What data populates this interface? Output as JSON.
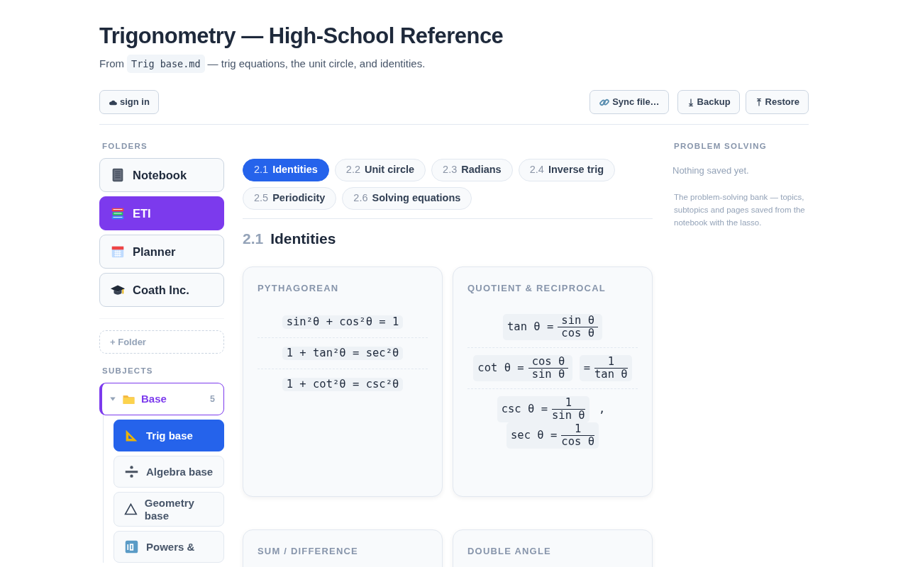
{
  "header": {
    "title": "Trigonometry — High-School Reference",
    "subtitle_before": "From",
    "file": "Trig base.md",
    "subtitle_after": "— trig equations, the unit circle, and identities."
  },
  "toolbar": {
    "sign_in": "sign in",
    "right": [
      {
        "label": "Sync file…",
        "kind": "link"
      },
      {
        "label": "Backup",
        "kind": "down"
      },
      {
        "label": "Restore",
        "kind": "up"
      }
    ]
  },
  "folders": {
    "heading": "FOLDERS",
    "items": [
      {
        "label": "Notebook",
        "selected": false
      },
      {
        "label": "ETI",
        "selected": true
      },
      {
        "label": "Planner",
        "selected": false
      },
      {
        "label": "Coath Inc.",
        "selected": false
      }
    ],
    "add": "+ Folder"
  },
  "subjects": {
    "heading": "SUBJECTS",
    "group": {
      "label": "Base",
      "count": "5",
      "expanded": true,
      "children": [
        {
          "label": "Trig base",
          "selected": true
        },
        {
          "label": "Algebra base",
          "selected": false
        },
        {
          "label": "Geometry base",
          "selected": false
        },
        {
          "label": "Powers &",
          "selected": false
        }
      ]
    }
  },
  "tabs": [
    {
      "num": "2.1",
      "label": "Identities",
      "selected": true
    },
    {
      "num": "2.2",
      "label": "Unit circle",
      "selected": false
    },
    {
      "num": "2.3",
      "label": "Radians",
      "selected": false
    },
    {
      "num": "2.4",
      "label": "Inverse trig",
      "selected": false
    },
    {
      "num": "2.5",
      "label": "Periodicity",
      "selected": false
    },
    {
      "num": "2.6",
      "label": "Solving equations",
      "selected": false
    }
  ],
  "section": {
    "num": "2.1",
    "title": "Identities"
  },
  "cards": [
    {
      "title": "PYTHAGOREAN",
      "formulas": [
        [
          {
            "text": "sin²θ + cos²θ = 1"
          }
        ],
        [
          {
            "text": "1 + tan²θ = sec²θ"
          }
        ],
        [
          {
            "text": "1 + cot²θ = csc²θ"
          }
        ]
      ]
    },
    {
      "title": "QUOTIENT & RECIPROCAL",
      "formulas": [
        [
          {
            "text": "tan θ =",
            "num": "sin θ",
            "den": "cos θ"
          }
        ],
        [
          {
            "text": "cot θ =",
            "num": "cos θ",
            "den": "sin θ"
          },
          {
            "text": "=",
            "num": "1",
            "den": "tan θ"
          }
        ],
        [
          {
            "text": "csc θ =",
            "num": "1",
            "den": "sin θ"
          },
          {
            "text": ","
          },
          {
            "text": "sec θ =",
            "num": "1",
            "den": "cos θ"
          }
        ]
      ]
    },
    {
      "title": "SUM / DIFFERENCE"
    },
    {
      "title": "DOUBLE ANGLE"
    }
  ],
  "problem_solving": {
    "heading": "PROBLEM SOLVING",
    "empty": "Nothing saved yet.",
    "note": "The problem-solving bank — topics, subtopics and pages saved from the notebook with the lasso."
  }
}
